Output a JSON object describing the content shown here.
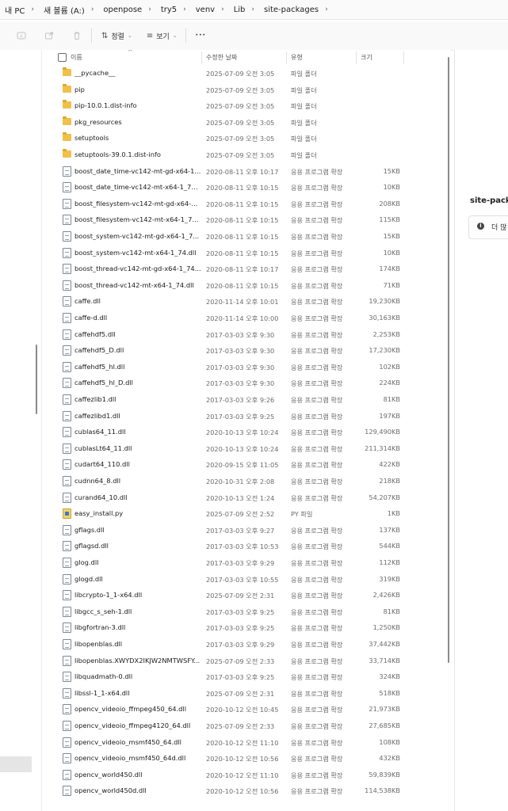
{
  "breadcrumb": [
    {
      "label": "내 PC"
    },
    {
      "label": "새 볼륨 (A:)"
    },
    {
      "label": "openpose"
    },
    {
      "label": "try5"
    },
    {
      "label": "venv"
    },
    {
      "label": "Lib"
    },
    {
      "label": "site-packages"
    }
  ],
  "breadcrumb_separator": "›",
  "toolbar": {
    "sort_label": "정렬",
    "view_label": "보기",
    "more_label": "···",
    "sort_glyph": "⇅",
    "view_glyph": "≡",
    "chevron": "⌄"
  },
  "columns": {
    "name": "이름",
    "date": "수정한 날짜",
    "type": "유형",
    "size": "크기",
    "sort_caret": "^"
  },
  "files": [
    {
      "name": "__pycache__",
      "date": "2025-07-09 오전 3:05",
      "type": "파일 폴더",
      "size": "",
      "icon": "folder"
    },
    {
      "name": "pip",
      "date": "2025-07-09 오전 3:05",
      "type": "파일 폴더",
      "size": "",
      "icon": "folder"
    },
    {
      "name": "pip-10.0.1.dist-info",
      "date": "2025-07-09 오전 3:05",
      "type": "파일 폴더",
      "size": "",
      "icon": "folder"
    },
    {
      "name": "pkg_resources",
      "date": "2025-07-09 오전 3:05",
      "type": "파일 폴더",
      "size": "",
      "icon": "folder"
    },
    {
      "name": "setuptools",
      "date": "2025-07-09 오전 3:05",
      "type": "파일 폴더",
      "size": "",
      "icon": "folder"
    },
    {
      "name": "setuptools-39.0.1.dist-info",
      "date": "2025-07-09 오전 3:05",
      "type": "파일 폴더",
      "size": "",
      "icon": "folder"
    },
    {
      "name": "boost_date_time-vc142-mt-gd-x64-1...",
      "date": "2020-08-11 오후 10:17",
      "type": "응용 프로그램 확장",
      "size": "15KB",
      "icon": "file"
    },
    {
      "name": "boost_date_time-vc142-mt-x64-1_74...",
      "date": "2020-08-11 오후 10:15",
      "type": "응용 프로그램 확장",
      "size": "10KB",
      "icon": "file"
    },
    {
      "name": "boost_filesystem-vc142-mt-gd-x64-1...",
      "date": "2020-08-11 오후 10:15",
      "type": "응용 프로그램 확장",
      "size": "208KB",
      "icon": "file"
    },
    {
      "name": "boost_filesystem-vc142-mt-x64-1_74...",
      "date": "2020-08-11 오후 10:15",
      "type": "응용 프로그램 확장",
      "size": "115KB",
      "icon": "file"
    },
    {
      "name": "boost_system-vc142-mt-gd-x64-1_7...",
      "date": "2020-08-11 오후 10:15",
      "type": "응용 프로그램 확장",
      "size": "15KB",
      "icon": "file"
    },
    {
      "name": "boost_system-vc142-mt-x64-1_74.dll",
      "date": "2020-08-11 오후 10:15",
      "type": "응용 프로그램 확장",
      "size": "10KB",
      "icon": "file"
    },
    {
      "name": "boost_thread-vc142-mt-gd-x64-1_74...",
      "date": "2020-08-11 오후 10:17",
      "type": "응용 프로그램 확장",
      "size": "174KB",
      "icon": "file"
    },
    {
      "name": "boost_thread-vc142-mt-x64-1_74.dll",
      "date": "2020-08-11 오후 10:15",
      "type": "응용 프로그램 확장",
      "size": "71KB",
      "icon": "file"
    },
    {
      "name": "caffe.dll",
      "date": "2020-11-14 오후 10:01",
      "type": "응용 프로그램 확장",
      "size": "19,230KB",
      "icon": "file"
    },
    {
      "name": "caffe-d.dll",
      "date": "2020-11-14 오후 10:00",
      "type": "응용 프로그램 확장",
      "size": "30,163KB",
      "icon": "file"
    },
    {
      "name": "caffehdf5.dll",
      "date": "2017-03-03 오후 9:30",
      "type": "응용 프로그램 확장",
      "size": "2,253KB",
      "icon": "file"
    },
    {
      "name": "caffehdf5_D.dll",
      "date": "2017-03-03 오후 9:30",
      "type": "응용 프로그램 확장",
      "size": "17,230KB",
      "icon": "file"
    },
    {
      "name": "caffehdf5_hl.dll",
      "date": "2017-03-03 오후 9:30",
      "type": "응용 프로그램 확장",
      "size": "102KB",
      "icon": "file"
    },
    {
      "name": "caffehdf5_hl_D.dll",
      "date": "2017-03-03 오후 9:30",
      "type": "응용 프로그램 확장",
      "size": "224KB",
      "icon": "file"
    },
    {
      "name": "caffezlib1.dll",
      "date": "2017-03-03 오후 9:26",
      "type": "응용 프로그램 확장",
      "size": "81KB",
      "icon": "file"
    },
    {
      "name": "caffezlibd1.dll",
      "date": "2017-03-03 오후 9:25",
      "type": "응용 프로그램 확장",
      "size": "197KB",
      "icon": "file"
    },
    {
      "name": "cublas64_11.dll",
      "date": "2020-10-13 오후 10:24",
      "type": "응용 프로그램 확장",
      "size": "129,490KB",
      "icon": "file"
    },
    {
      "name": "cublasLt64_11.dll",
      "date": "2020-10-13 오후 10:24",
      "type": "응용 프로그램 확장",
      "size": "211,314KB",
      "icon": "file"
    },
    {
      "name": "cudart64_110.dll",
      "date": "2020-09-15 오후 11:05",
      "type": "응용 프로그램 확장",
      "size": "422KB",
      "icon": "file"
    },
    {
      "name": "cudnn64_8.dll",
      "date": "2020-10-31 오후 2:08",
      "type": "응용 프로그램 확장",
      "size": "218KB",
      "icon": "file"
    },
    {
      "name": "curand64_10.dll",
      "date": "2020-10-13 오전 1:24",
      "type": "응용 프로그램 확장",
      "size": "54,207KB",
      "icon": "file"
    },
    {
      "name": "easy_install.py",
      "date": "2025-07-09 오전 2:52",
      "type": "PY 파일",
      "size": "1KB",
      "icon": "py"
    },
    {
      "name": "gflags.dll",
      "date": "2017-03-03 오후 9:27",
      "type": "응용 프로그램 확장",
      "size": "137KB",
      "icon": "file"
    },
    {
      "name": "gflagsd.dll",
      "date": "2017-03-03 오후 10:53",
      "type": "응용 프로그램 확장",
      "size": "544KB",
      "icon": "file"
    },
    {
      "name": "glog.dll",
      "date": "2017-03-03 오후 9:29",
      "type": "응용 프로그램 확장",
      "size": "112KB",
      "icon": "file"
    },
    {
      "name": "glogd.dll",
      "date": "2017-03-03 오후 10:55",
      "type": "응용 프로그램 확장",
      "size": "319KB",
      "icon": "file"
    },
    {
      "name": "libcrypto-1_1-x64.dll",
      "date": "2025-07-09 오전 2:31",
      "type": "응용 프로그램 확장",
      "size": "2,426KB",
      "icon": "file"
    },
    {
      "name": "libgcc_s_seh-1.dll",
      "date": "2017-03-03 오후 9:25",
      "type": "응용 프로그램 확장",
      "size": "81KB",
      "icon": "file"
    },
    {
      "name": "libgfortran-3.dll",
      "date": "2017-03-03 오후 9:25",
      "type": "응용 프로그램 확장",
      "size": "1,250KB",
      "icon": "file"
    },
    {
      "name": "libopenblas.dll",
      "date": "2017-03-03 오후 9:29",
      "type": "응용 프로그램 확장",
      "size": "37,442KB",
      "icon": "file"
    },
    {
      "name": "libopenblas.XWYDX2IKJW2NMTWSFY...",
      "date": "2025-07-09 오전 2:33",
      "type": "응용 프로그램 확장",
      "size": "33,714KB",
      "icon": "file"
    },
    {
      "name": "libquadmath-0.dll",
      "date": "2017-03-03 오후 9:25",
      "type": "응용 프로그램 확장",
      "size": "324KB",
      "icon": "file"
    },
    {
      "name": "libssl-1_1-x64.dll",
      "date": "2025-07-09 오전 2:31",
      "type": "응용 프로그램 확장",
      "size": "518KB",
      "icon": "file"
    },
    {
      "name": "opencv_videoio_ffmpeg450_64.dll",
      "date": "2020-10-12 오전 10:45",
      "type": "응용 프로그램 확장",
      "size": "21,973KB",
      "icon": "file"
    },
    {
      "name": "opencv_videoio_ffmpeg4120_64.dll",
      "date": "2025-07-09 오전 2:33",
      "type": "응용 프로그램 확장",
      "size": "27,685KB",
      "icon": "file"
    },
    {
      "name": "opencv_videoio_msmf450_64.dll",
      "date": "2020-10-12 오전 11:10",
      "type": "응용 프로그램 확장",
      "size": "108KB",
      "icon": "file"
    },
    {
      "name": "opencv_videoio_msmf450_64d.dll",
      "date": "2020-10-12 오전 10:56",
      "type": "응용 프로그램 확장",
      "size": "432KB",
      "icon": "file"
    },
    {
      "name": "opencv_world450.dll",
      "date": "2020-10-12 오전 11:10",
      "type": "응용 프로그램 확장",
      "size": "59,839KB",
      "icon": "file"
    },
    {
      "name": "opencv_world450d.dll",
      "date": "2020-10-12 오전 10:56",
      "type": "응용 프로그램 확장",
      "size": "114,538KB",
      "icon": "file"
    }
  ],
  "details_pane": {
    "title": "site-pack",
    "info_text": "더 많",
    "info_glyph": "i"
  },
  "colors": {
    "folder": "#f0c04a",
    "accent": "#0067c0"
  }
}
